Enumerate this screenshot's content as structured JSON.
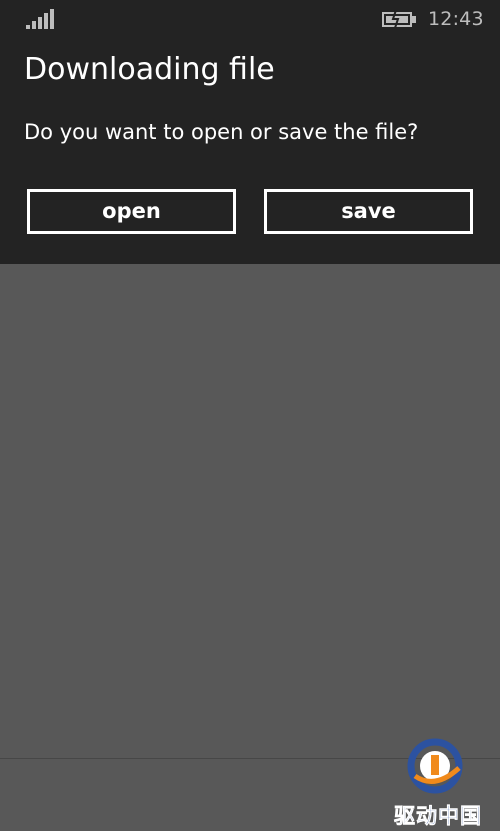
{
  "status_bar": {
    "signal_icon": "signal-strength-icon",
    "battery_icon": "battery-charging-icon",
    "time": "12:43"
  },
  "dialog": {
    "title": "Downloading file",
    "message": "Do you want to open or save the file?",
    "open_label": "open",
    "save_label": "save"
  },
  "watermark": {
    "text": "驱动中国"
  },
  "colors": {
    "dialog_background": "#232323",
    "screen_background": "#585858",
    "text": "#ffffff",
    "watermark_blue": "#2c52a0",
    "watermark_orange": "#f08a1c"
  }
}
